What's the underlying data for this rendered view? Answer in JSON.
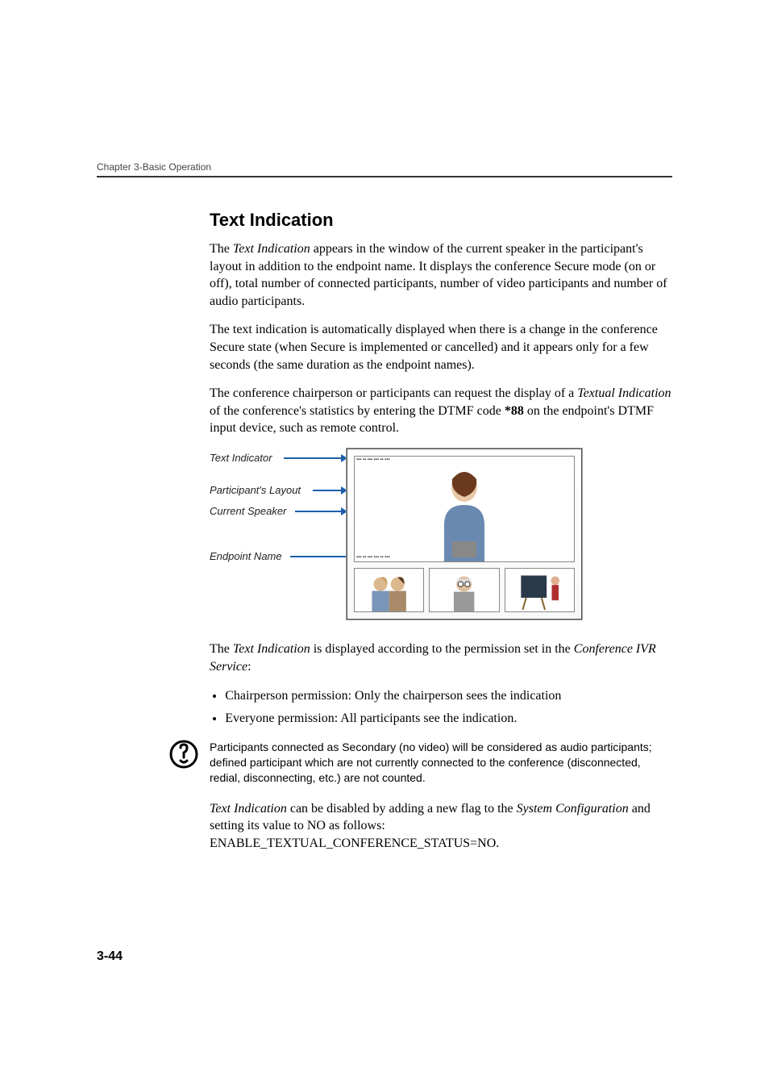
{
  "running_head": "Chapter 3-Basic Operation",
  "section_title": "Text Indication",
  "para1_a": "The ",
  "para1_b": "Text Indication",
  "para1_c": " appears in the window of the current speaker in the participant's layout in addition to the endpoint name. It displays the conference Secure mode (on or off), total number of connected participants, number of video participants and number of audio participants.",
  "para2": "The text indication is automatically displayed when there is a change in the conference Secure state (when Secure is implemented or cancelled) and it appears only for a few seconds (the same duration as the endpoint names).",
  "para3_a": "The conference chairperson or participants can request the display of a ",
  "para3_b": "Textual Indication",
  "para3_c": " of the conference's statistics by entering the DTMF code ",
  "para3_d": "*88",
  "para3_e": " on the endpoint's DTMF input device, such as remote control.",
  "callouts": {
    "text_indicator": "Text Indicator",
    "participants_layout": "Participant's Layout",
    "current_speaker": "Current Speaker",
    "endpoint_name": "Endpoint Name"
  },
  "para4_a": "The ",
  "para4_b": "Text Indication",
  "para4_c": " is displayed according to the permission set in the ",
  "para4_d": "Conference IVR Service",
  "para4_e": ":",
  "bullet1": "Chairperson permission: Only the chairperson sees the indication",
  "bullet2": "Everyone permission: All participants see the indication.",
  "note": "Participants connected as Secondary (no video) will be considered as audio participants; defined participant which are not currently connected to the conference (disconnected, redial, disconnecting, etc.) are not counted.",
  "para5_a": "Text Indication",
  "para5_b": " can be disabled by adding a new flag to the ",
  "para5_c": "System Configuration",
  "para5_d": " and setting its value to NO as follows: ENABLE_TEXTUAL_CONFERENCE_STATUS=NO.",
  "page_number": "3-44"
}
